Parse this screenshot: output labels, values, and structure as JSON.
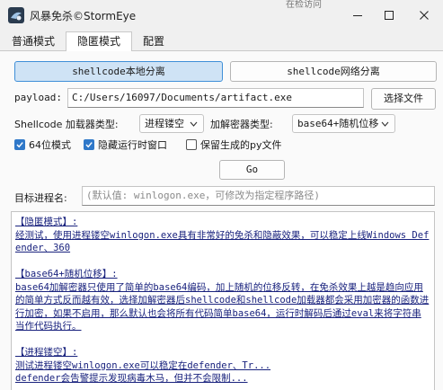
{
  "window": {
    "title": "风暴免杀©StormEye",
    "behind_text": "在检访问"
  },
  "tabs": [
    {
      "label": "普通模式",
      "active": false
    },
    {
      "label": "隐匿模式",
      "active": true
    },
    {
      "label": "配置",
      "active": false
    }
  ],
  "mode_buttons": {
    "local": "shellcode本地分离",
    "network": "shellcode网络分离"
  },
  "payload": {
    "label": "payload:",
    "value": "C:/Users/16097/Documents/artifact.exe",
    "choose_button": "选择文件"
  },
  "loader": {
    "label": "Shellcode 加载器类型:",
    "selected": "进程镂空"
  },
  "encryptor": {
    "label": "加解密器类型:",
    "selected": "base64+随机位移"
  },
  "options": [
    {
      "label": "64位模式",
      "checked": true
    },
    {
      "label": "隐藏运行时窗口",
      "checked": true
    },
    {
      "label": "保留生成的py文件",
      "checked": false
    }
  ],
  "go_button": "Go",
  "target": {
    "label": "目标进程名:",
    "placeholder": "(默认值: winlogon.exe，可修改为指定程序路径)"
  },
  "info_paragraphs": [
    "【隐匿模式】:\n经测试，使用进程镂空winlogon.exe具有非常好的免杀和隐蔽效果，可以稳定上线Windows Defender、360",
    "【base64+随机位移】:\nbase64加解密器只使用了简单的base64编码，加上随机的位移反转，在免杀效果上越是趋向应用的简单方式反而越有效，选择加解密器后shellcode和shellcode加载器都会采用加密器的函数进行加密，如果不启用，那么默认也会将所有代码简单base64，运行时解码后通过eval来将字符串当作代码执行。",
    "【进程镂空】:\n测试进程镂空winlogon.exe可以稳定在defender、Tr...\ndefender会告警提示发现病毒木马，但并不会限制..."
  ],
  "colors": {
    "accent": "#2f78c9",
    "primary_button_bg": "#cfe3f5",
    "link_text": "#1a237e"
  }
}
